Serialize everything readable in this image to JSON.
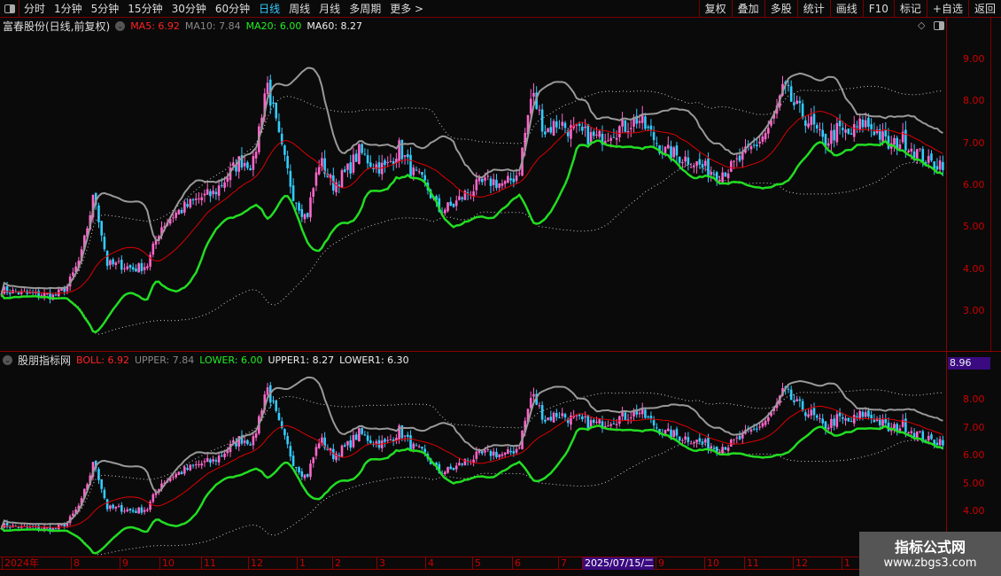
{
  "toolbar": {
    "periods": [
      "分时",
      "1分钟",
      "5分钟",
      "15分钟",
      "30分钟",
      "60分钟",
      "日线",
      "周线",
      "月线",
      "多周期",
      "更多 >"
    ],
    "active": "日线",
    "right": [
      "复权",
      "叠加",
      "多股",
      "统计",
      "画线",
      "F10",
      "标记",
      "+自选",
      "返回"
    ]
  },
  "main": {
    "title": "富春股份(日线,前复权)",
    "ma5": "MA5: 6.92",
    "ma10": "MA10: 7.84",
    "ma20": "MA20: 6.00",
    "ma60": "MA60: 8.27",
    "axis": [
      "9.00",
      "8.00",
      "7.00",
      "6.00",
      "5.00",
      "4.00",
      "3.00"
    ]
  },
  "indicator": {
    "title": "股朋指标网",
    "boll": "BOLL: 6.92",
    "upper": "UPPER: 7.84",
    "lower": "LOWER: 6.00",
    "upper1": "UPPER1: 8.27",
    "lower1": "LOWER1: 6.30",
    "axis": [
      "8.00",
      "7.00",
      "6.00",
      "5.00",
      "4.00"
    ],
    "cursor_value": "8.96"
  },
  "dates": [
    "2024年",
    "8",
    "9",
    "10",
    "11",
    "12",
    "1",
    "2",
    "3",
    "4",
    "5",
    "6",
    "7",
    "2025/07/15/二",
    "9",
    "10",
    "11",
    "12",
    "1"
  ],
  "watermark": {
    "title": "指标公式网",
    "url": "www.zbgs3.com"
  },
  "colors": {
    "up": "#ff66cc",
    "down": "#33ccff",
    "mid": "#dd0000",
    "upper": "#999999",
    "lower": "#22dd22",
    "axis": "#cc0000",
    "cursor_bg": "#3a0a80"
  },
  "chart_data": {
    "type": "candlestick",
    "closes": [
      3.5,
      3.45,
      3.4,
      3.4,
      3.35,
      3.6,
      4.3,
      5.8,
      4.1,
      4.1,
      4.0,
      4.1,
      5.0,
      5.3,
      5.5,
      5.7,
      5.8,
      6.2,
      6.6,
      6.5,
      8.5,
      7.0,
      5.8,
      5.2,
      6.6,
      6.0,
      6.3,
      6.8,
      6.5,
      6.4,
      6.9,
      6.3,
      6.0,
      5.4,
      5.5,
      5.8,
      6.0,
      6.1,
      6.0,
      6.3,
      8.2,
      7.3,
      7.5,
      7.3,
      7.2,
      7.1,
      7.3,
      7.4,
      7.6,
      7.2,
      6.8,
      6.7,
      6.6,
      6.4,
      6.3,
      6.4,
      6.7,
      7.0,
      7.4,
      8.3,
      7.8,
      7.5,
      7.0,
      7.3,
      7.2,
      7.5,
      7.3,
      6.9,
      7.1,
      6.8,
      6.5,
      6.55
    ]
  }
}
